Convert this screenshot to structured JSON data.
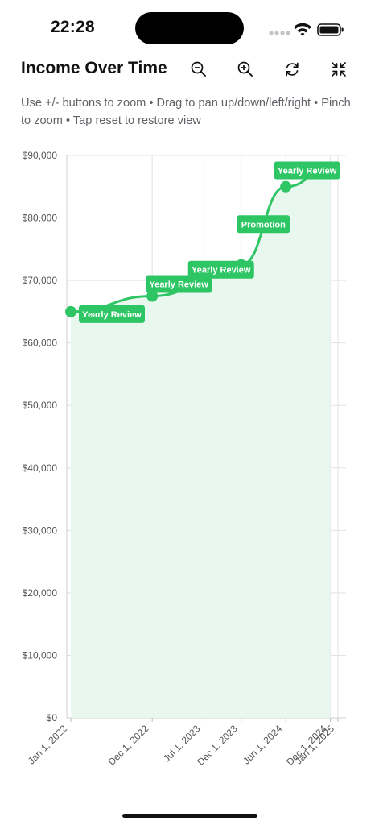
{
  "status_bar": {
    "time": "22:28"
  },
  "header": {
    "title": "Income Over Time",
    "buttons": [
      {
        "icon": "zoom-out-icon"
      },
      {
        "icon": "zoom-in-icon"
      },
      {
        "icon": "reset-icon"
      },
      {
        "icon": "collapse-icon"
      }
    ]
  },
  "subtitle": "Use +/- buttons to zoom • Drag to pan up/down/left/right • Pinch to zoom • Tap reset to restore view",
  "colors": {
    "accent": "#2ec565",
    "fill": "#e8f8ee",
    "grid": "#e3e3e3",
    "axis_text": "#555555"
  },
  "chart_data": {
    "type": "area",
    "title": "",
    "xlabel": "",
    "ylabel": "",
    "ylim": [
      0,
      90000
    ],
    "y_ticks": [
      "$0",
      "$10,000",
      "$20,000",
      "$30,000",
      "$40,000",
      "$50,000",
      "$60,000",
      "$70,000",
      "$80,000",
      "$90,000"
    ],
    "x_ticks": [
      "Jan 1, 2022",
      "Dec 1, 2022",
      "Jul 1, 2023",
      "Dec 1, 2023",
      "Jun 1, 2024",
      "Dec 1, 2024",
      "Jan 1, 2025"
    ],
    "grid": true,
    "series": [
      {
        "points": [
          {
            "x": "2022-01-01",
            "y": 65000
          },
          {
            "x": "2022-12-01",
            "y": 67500
          },
          {
            "x": "2023-12-01",
            "y": 72500
          },
          {
            "x": "2024-06-01",
            "y": 85000
          },
          {
            "x": "2024-12-01",
            "y": 88000
          }
        ]
      }
    ],
    "annotations": [
      {
        "label": "Yearly Review",
        "x": "2022-01-01",
        "y": 65000
      },
      {
        "label": "Yearly Review",
        "x": "2022-12-01",
        "y": 67500
      },
      {
        "label": "Yearly Review",
        "x": "2023-12-01",
        "y": 72500
      },
      {
        "label": "Promotion",
        "x": "2024-03-01",
        "y": 79000
      },
      {
        "label": "Yearly Review",
        "x": "2024-12-01",
        "y": 88000
      }
    ]
  }
}
